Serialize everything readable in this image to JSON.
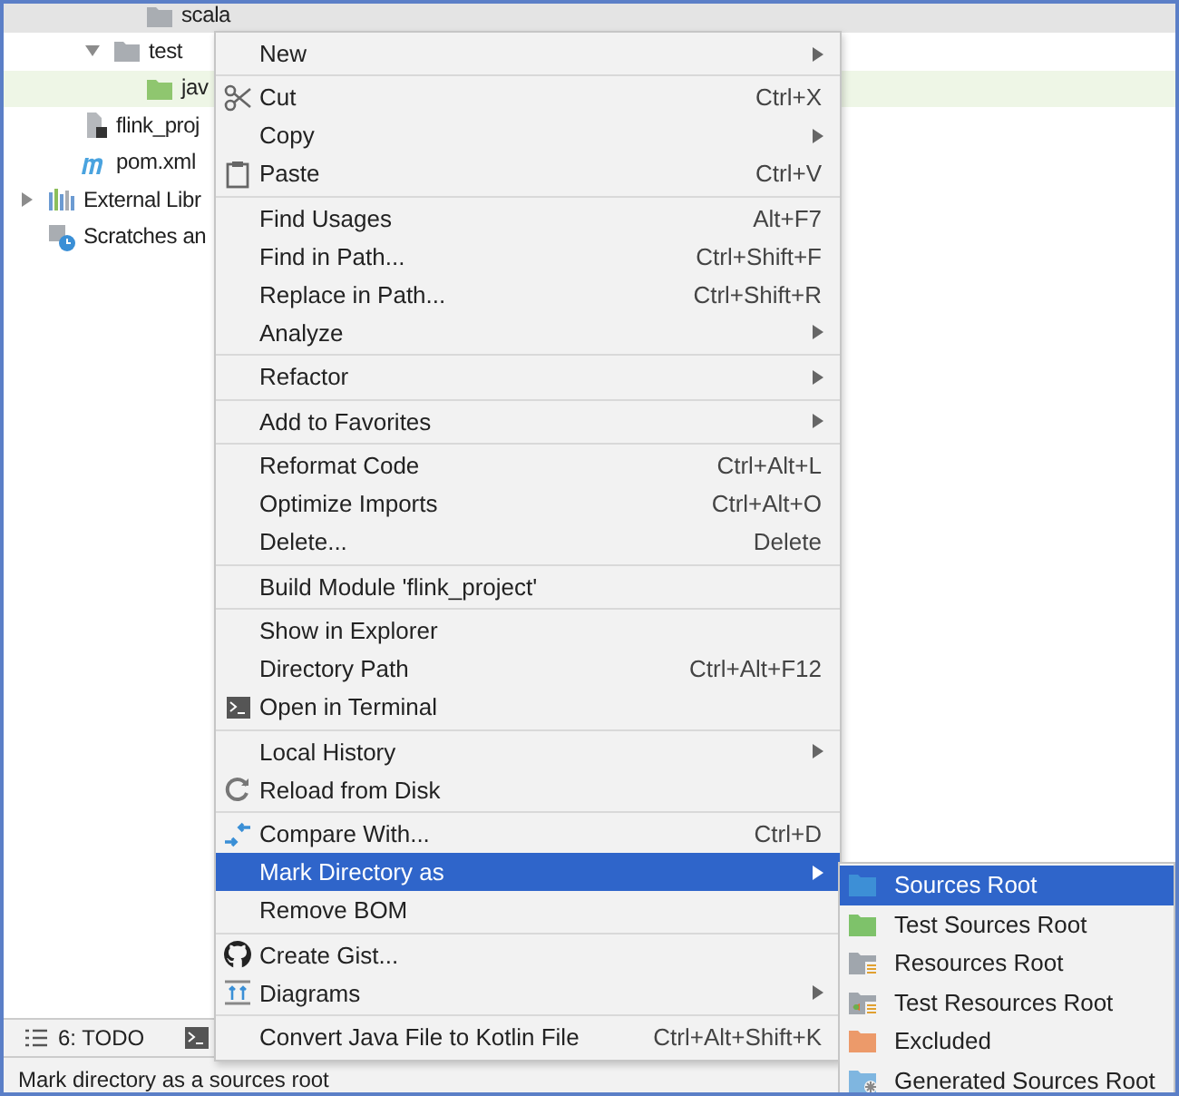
{
  "tree": [
    {
      "children": [
        {
          "children": [
            {
              "children": [
                {
                  "label": "scala",
                  "kind": "folder",
                  "color": "#e4e4e4"
                }
              ]
            },
            {
              "label": "test",
              "kind": "folder",
              "expanded": true,
              "children": [
                {
                  "label": "jav",
                  "kind": "test-folder",
                  "color": "#eef6e6"
                }
              ]
            }
          ]
        },
        {
          "label": "flink_proj",
          "kind": "module-file"
        },
        {
          "label": "pom.xml",
          "kind": "maven"
        }
      ]
    },
    {
      "label": "External Libr",
      "kind": "libraries",
      "expanded": false
    },
    {
      "label": "Scratches an",
      "kind": "scratches"
    }
  ],
  "bottom_toolbar": {
    "todo": "6: TODO"
  },
  "status_bar": "Mark directory as a sources root",
  "menu": [
    [
      {
        "label": "New",
        "submenu": true,
        "selected": false
      }
    ],
    [
      {
        "label": "Cut",
        "kind": "scissors",
        "shortcut": "Ctrl+X",
        "selected": false
      },
      {
        "label": "Copy",
        "submenu": true,
        "selected": false
      },
      {
        "label": "Paste",
        "kind": "clipboard",
        "shortcut": "Ctrl+V",
        "selected": false
      }
    ],
    [
      {
        "label": "Find Usages",
        "shortcut": "Alt+F7",
        "selected": false
      },
      {
        "label": "Find in Path...",
        "shortcut": "Ctrl+Shift+F",
        "selected": false
      },
      {
        "label": "Replace in Path...",
        "shortcut": "Ctrl+Shift+R",
        "selected": false
      },
      {
        "label": "Analyze",
        "submenu": true,
        "selected": false
      }
    ],
    [
      {
        "label": "Refactor",
        "submenu": true,
        "selected": false
      }
    ],
    [
      {
        "label": "Add to Favorites",
        "submenu": true,
        "selected": false
      }
    ],
    [
      {
        "label": "Reformat Code",
        "shortcut": "Ctrl+Alt+L",
        "selected": false
      },
      {
        "label": "Optimize Imports",
        "shortcut": "Ctrl+Alt+O",
        "selected": false
      },
      {
        "label": "Delete...",
        "shortcut": "Delete",
        "selected": false
      }
    ],
    [
      {
        "label": "Build Module 'flink_project'",
        "selected": false
      }
    ],
    [
      {
        "label": "Show in Explorer",
        "selected": false
      },
      {
        "label": "Directory Path",
        "shortcut": "Ctrl+Alt+F12",
        "selected": false
      },
      {
        "label": "Open in Terminal",
        "kind": "terminal",
        "selected": false
      }
    ],
    [
      {
        "label": "Local History",
        "submenu": true,
        "selected": false
      },
      {
        "label": "Reload from Disk",
        "kind": "reload",
        "selected": false
      }
    ],
    [
      {
        "label": "Compare With...",
        "kind": "compare",
        "shortcut": "Ctrl+D",
        "selected": false
      },
      {
        "label": "Mark Directory as",
        "submenu": true,
        "selected": true
      },
      {
        "label": "Remove BOM",
        "selected": false
      }
    ],
    [
      {
        "label": "Create Gist...",
        "kind": "github",
        "selected": false
      },
      {
        "label": "Diagrams",
        "kind": "diagram",
        "submenu": true,
        "selected": false
      }
    ],
    [
      {
        "label": "Convert Java File to Kotlin File",
        "shortcut": "Ctrl+Alt+Shift+K",
        "selected": false
      }
    ]
  ],
  "submenu": [
    {
      "label": "Sources Root",
      "kind": "sources",
      "selected": true
    },
    {
      "label": "Test Sources Root",
      "kind": "test-sources",
      "selected": false
    },
    {
      "label": "Resources Root",
      "kind": "resources",
      "selected": false
    },
    {
      "label": "Test Resources Root",
      "kind": "test-resources",
      "selected": false
    },
    {
      "label": "Excluded",
      "kind": "excluded",
      "selected": false
    },
    {
      "label": "Generated Sources Root",
      "kind": "generated",
      "selected": false
    }
  ]
}
